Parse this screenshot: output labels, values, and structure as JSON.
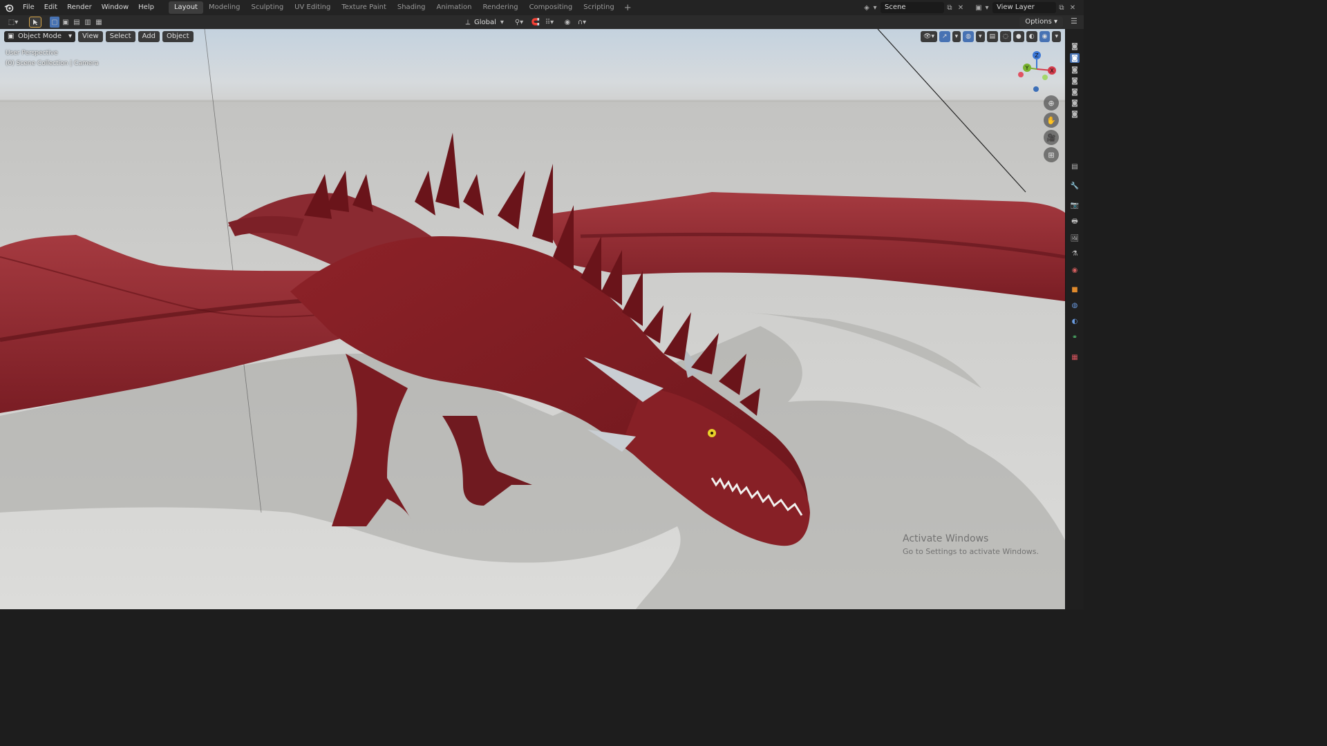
{
  "menu": [
    "File",
    "Edit",
    "Render",
    "Window",
    "Help"
  ],
  "workspace_tabs": [
    "Layout",
    "Modeling",
    "Sculpting",
    "UV Editing",
    "Texture Paint",
    "Shading",
    "Animation",
    "Rendering",
    "Compositing",
    "Scripting"
  ],
  "active_tab": "Layout",
  "scene_name": "Scene",
  "view_layer": "View Layer",
  "transform_orientation": "Global",
  "options_label": "Options",
  "viewport": {
    "mode": "Object Mode",
    "menus": [
      "View",
      "Select",
      "Add",
      "Object"
    ],
    "perspective_label": "User Perspective",
    "collection_label": "(0) Scene Collection | Camera"
  },
  "gizmo_axes": {
    "x": "X",
    "y": "Y",
    "z": "Z"
  },
  "watermark": {
    "title": "Activate Windows",
    "subtitle": "Go to Settings to activate Windows."
  },
  "colors": {
    "accent": "#4772b3",
    "dragon": "#8e2329",
    "ground": "#c9c9c7"
  }
}
